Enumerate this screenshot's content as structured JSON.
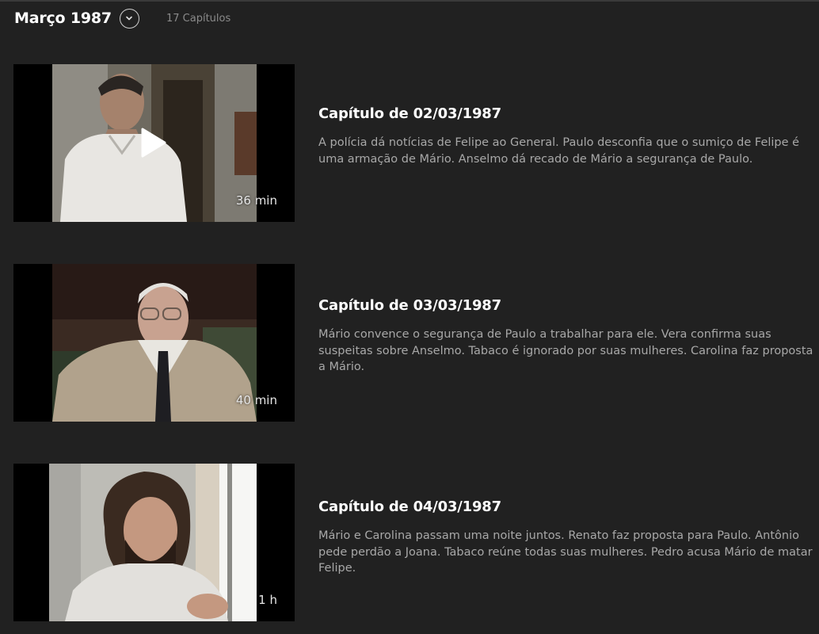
{
  "header": {
    "month": "Março 1987",
    "count": "17 Capítulos"
  },
  "episodes": [
    {
      "title": "Capítulo de 02/03/1987",
      "description": "A polícia dá notícias de Felipe ao General. Paulo desconfia que o sumiço de Felipe é uma armação de Mário. Anselmo dá recado de Mário a segurança de Paulo.",
      "duration": "36 min"
    },
    {
      "title": "Capítulo de 03/03/1987",
      "description": "Mário convence o segurança de Paulo a trabalhar para ele. Vera confirma suas suspeitas sobre Anselmo. Tabaco é ignorado por suas mulheres. Carolina faz proposta a Mário.",
      "duration": "40 min"
    },
    {
      "title": "Capítulo de 04/03/1987",
      "description": "Mário e Carolina passam uma noite juntos. Renato faz proposta para Paulo. Antônio pede perdão a Joana. Tabaco reúne todas suas mulheres. Pedro acusa Mário de matar Felipe.",
      "duration": "1 h"
    }
  ]
}
